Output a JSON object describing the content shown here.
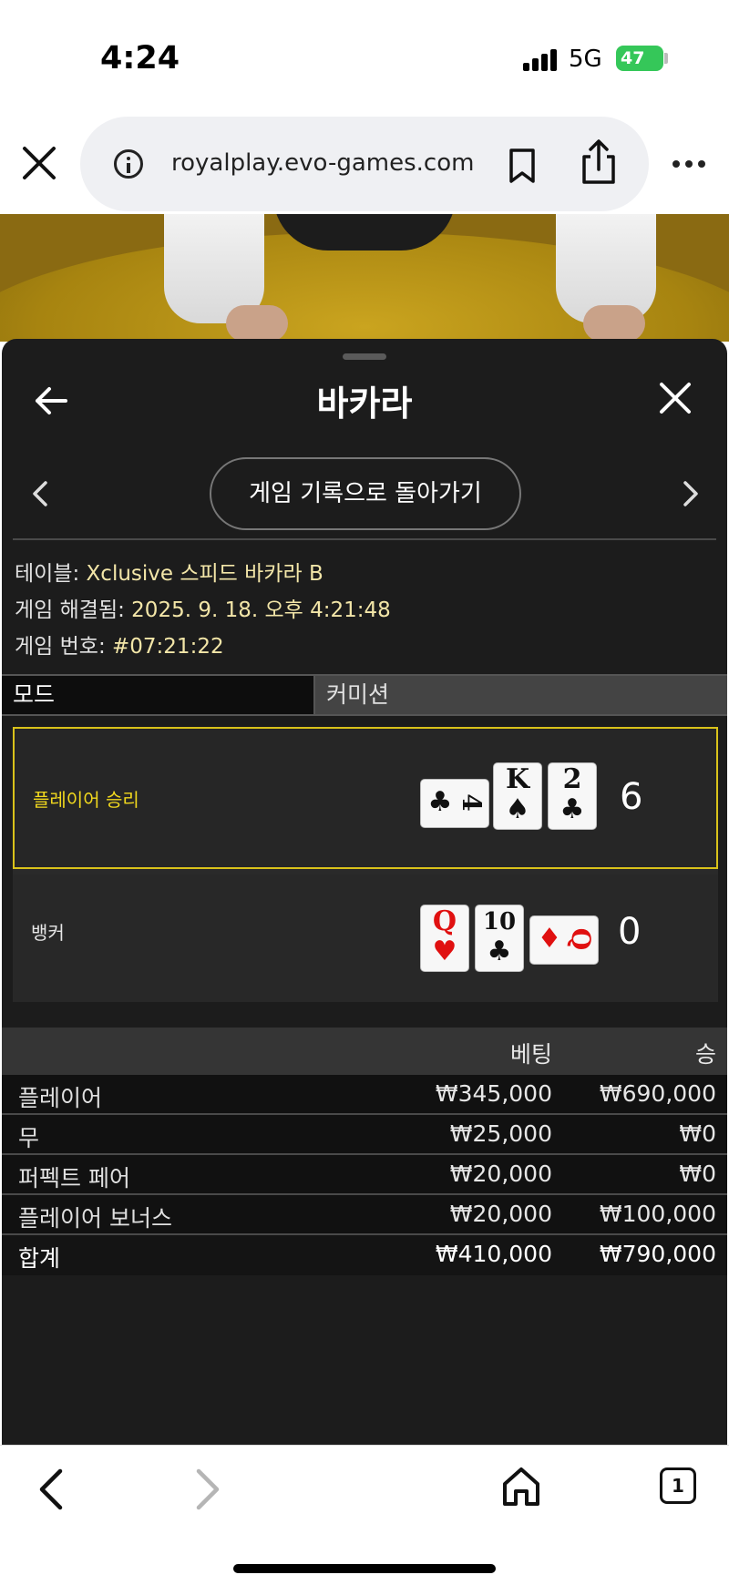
{
  "status_bar": {
    "time": "4:24",
    "network": "5G",
    "battery": "47"
  },
  "browser": {
    "url": "royalplay.evo-games.com",
    "tab_count": "1"
  },
  "panel": {
    "title": "바카라",
    "back_to_history": "게임 기록으로 돌아가기",
    "info": [
      {
        "label": "테이블: ",
        "value": "Xclusive 스피드 바카라 B"
      },
      {
        "label": "게임 해결됨: ",
        "value": "2025. 9. 18. 오후 4:21:48"
      },
      {
        "label": "게임 번호: ",
        "value": "#07:21:22"
      }
    ],
    "mode_label": "모드",
    "commission_label": "커미션"
  },
  "hands": {
    "player": {
      "label": "플레이어 승리",
      "score": "6",
      "cards": [
        {
          "rank": "4",
          "suit": "♣",
          "color": "black"
        },
        {
          "rank": "K",
          "suit": "♠",
          "color": "black"
        },
        {
          "rank": "2",
          "suit": "♣",
          "color": "black"
        }
      ]
    },
    "banker": {
      "label": "뱅커",
      "score": "0",
      "cards": [
        {
          "rank": "Q",
          "suit": "♥",
          "color": "red"
        },
        {
          "rank": "10",
          "suit": "♣",
          "color": "black"
        },
        {
          "rank": "Q",
          "suit": "♦",
          "color": "red"
        }
      ]
    }
  },
  "bets": {
    "headers": {
      "bet": "베팅",
      "win": "승"
    },
    "rows": [
      {
        "name": "플레이어",
        "bet": "₩345,000",
        "win": "₩690,000"
      },
      {
        "name": "무",
        "bet": "₩25,000",
        "win": "₩0"
      },
      {
        "name": "퍼펙트 페어",
        "bet": "₩20,000",
        "win": "₩0"
      },
      {
        "name": "플레이어 보너스",
        "bet": "₩20,000",
        "win": "₩100,000"
      }
    ],
    "total": {
      "name": "합계",
      "bet": "₩410,000",
      "win": "₩790,000"
    }
  },
  "colors": {
    "panel_bg": "#1c1c1c",
    "winner_accent": "#f1d81e",
    "info_value": "#f3e6a8",
    "card_red": "#e01010"
  }
}
